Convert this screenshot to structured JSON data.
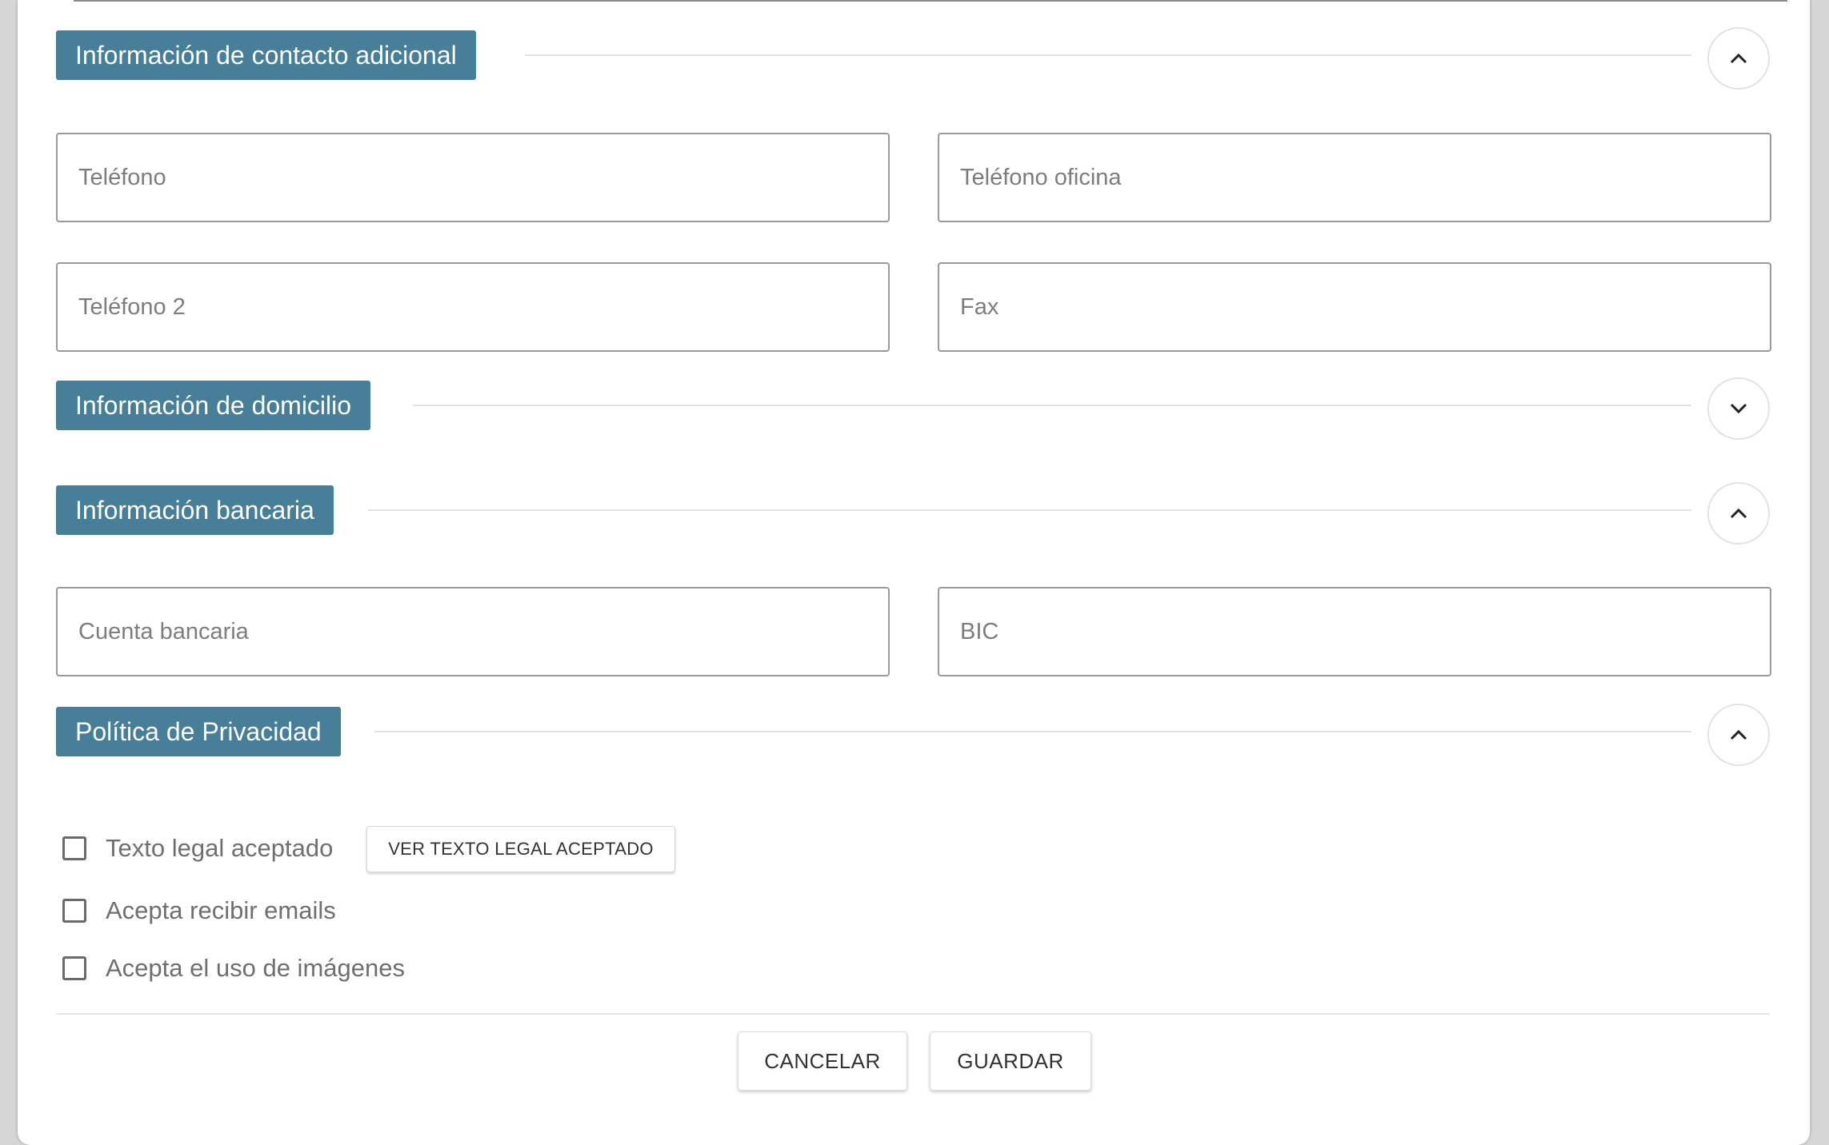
{
  "sections": {
    "contact": {
      "title": "Información de contacto adicional",
      "expanded": true
    },
    "address": {
      "title": "Información de domicilio",
      "expanded": false
    },
    "bank": {
      "title": "Información bancaria",
      "expanded": true
    },
    "privacy": {
      "title": "Política de Privacidad",
      "expanded": true
    }
  },
  "fields": {
    "telefono": {
      "placeholder": "Teléfono",
      "value": ""
    },
    "telefono_oficina": {
      "placeholder": "Teléfono oficina",
      "value": ""
    },
    "telefono2": {
      "placeholder": "Teléfono 2",
      "value": ""
    },
    "fax": {
      "placeholder": "Fax",
      "value": ""
    },
    "cuenta_bancaria": {
      "placeholder": "Cuenta bancaria",
      "value": ""
    },
    "bic": {
      "placeholder": "BIC",
      "value": ""
    }
  },
  "privacy": {
    "legal_text_label": "Texto legal aceptado",
    "legal_text_checked": false,
    "view_legal_button": "VER TEXTO LEGAL ACEPTADO",
    "emails_label": "Acepta recibir emails",
    "emails_checked": false,
    "images_label": "Acepta el uso de imágenes",
    "images_checked": false
  },
  "footer": {
    "cancel_label": "CANCELAR",
    "save_label": "GUARDAR"
  },
  "icons": {
    "expanded": "chevron-up-icon",
    "collapsed": "chevron-down-icon"
  },
  "colors": {
    "section_header_bg": "#487f98",
    "section_header_text": "#ffffff"
  }
}
